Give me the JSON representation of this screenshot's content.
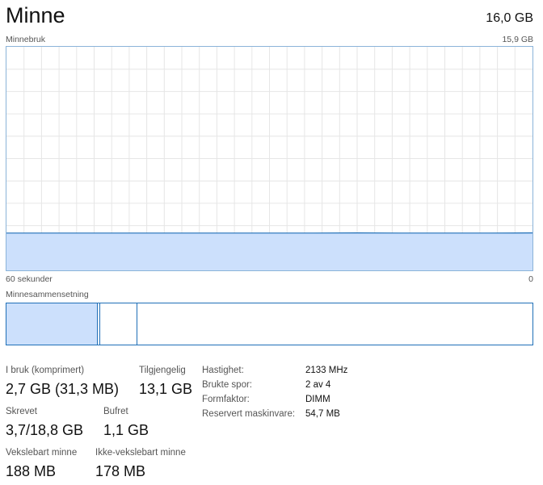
{
  "header": {
    "title": "Minne",
    "total": "16,0 GB"
  },
  "usage_graph": {
    "label": "Minnebruk",
    "max_label": "15,9 GB",
    "time_left_label": "60 sekunder",
    "time_right_label": "0",
    "fill_color": "#cce0fc",
    "line_color": "#1f6fb7",
    "grid_color": "#e6e6e6"
  },
  "chart_data": {
    "type": "area",
    "x": [
      60,
      55,
      50,
      45,
      40,
      35,
      30,
      25,
      20,
      15,
      10,
      5,
      0
    ],
    "values": [
      2.65,
      2.65,
      2.65,
      2.65,
      2.65,
      2.65,
      2.65,
      2.65,
      2.66,
      2.65,
      2.65,
      2.65,
      2.66
    ],
    "ylim": [
      0,
      15.9
    ],
    "grid": true
  },
  "composition": {
    "label": "Minnesammensetning",
    "in_use_fraction": 0.174,
    "modified_fraction": 0.004,
    "standby_fraction": 0.07,
    "fill_color": "#cce0fc",
    "border_color": "#1f6fb7"
  },
  "stats": {
    "in_use": {
      "label": "I bruk (komprimert)",
      "value": "2,7 GB (31,3 MB)"
    },
    "available": {
      "label": "Tilgjengelig",
      "value": "13,1 GB"
    },
    "committed": {
      "label": "Skrevet",
      "value": "3,7/18,8 GB"
    },
    "cached": {
      "label": "Bufret",
      "value": "1,1 GB"
    },
    "paged_pool": {
      "label": "Vekslebart minne",
      "value": "188 MB"
    },
    "nonpaged_pool": {
      "label": "Ikke-vekslebart minne",
      "value": "178 MB"
    }
  },
  "properties": [
    {
      "label": "Hastighet:",
      "value": "2133 MHz"
    },
    {
      "label": "Brukte spor:",
      "value": "2 av 4"
    },
    {
      "label": "Formfaktor:",
      "value": "DIMM"
    },
    {
      "label": "Reservert maskinvare:",
      "value": "54,7 MB"
    }
  ]
}
